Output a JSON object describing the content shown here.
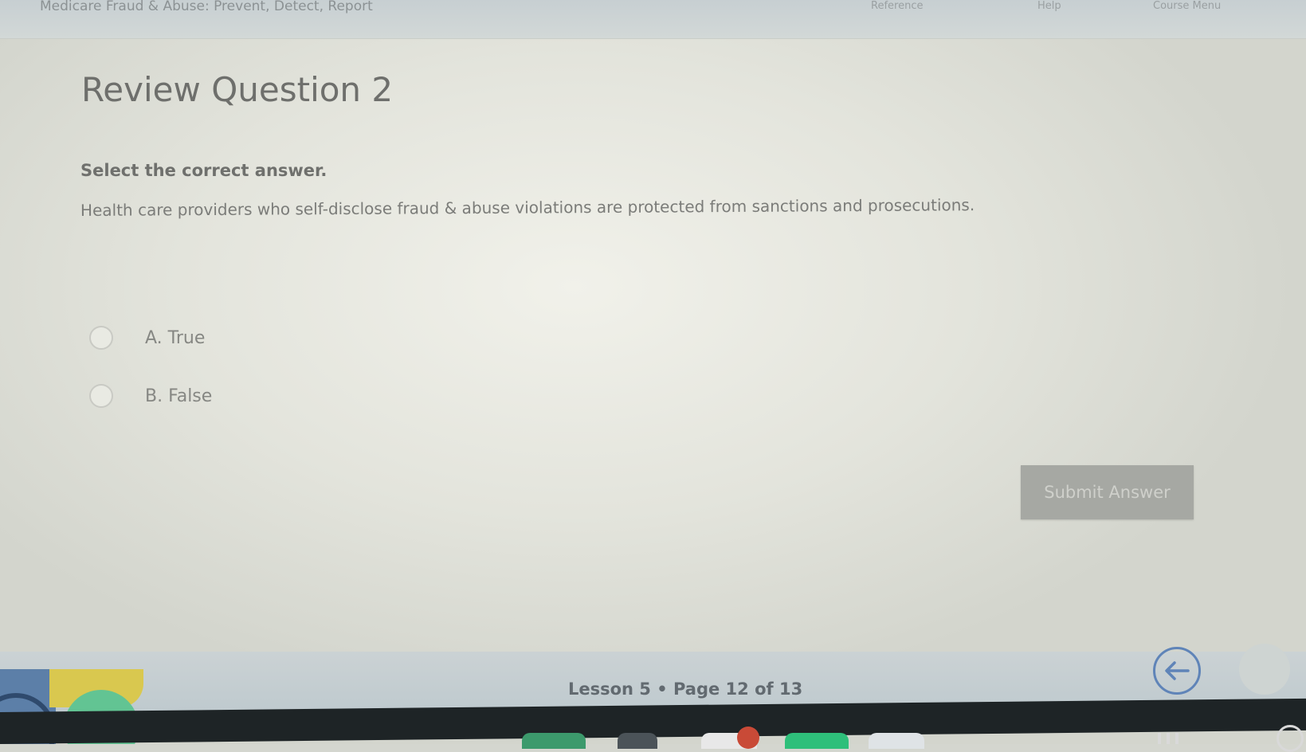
{
  "header": {
    "course_title": "Medicare Fraud & Abuse: Prevent, Detect, Report",
    "nav_links": [
      "Reference",
      "Help",
      "Course Menu"
    ]
  },
  "question": {
    "title": "Review Question 2",
    "instruction": "Select the correct answer.",
    "prompt": "Health care providers who self-disclose fraud & abuse violations are protected from sanctions and prosecutions.",
    "options": [
      {
        "label": "A. True",
        "selected": false
      },
      {
        "label": "B. False",
        "selected": false
      }
    ],
    "submit_label": "Submit Answer"
  },
  "footer": {
    "lesson_info": "Lesson 5 • Page 12 of 13"
  },
  "icons": {
    "back": "arrow-left-icon",
    "forward": "arrow-right-icon"
  },
  "colors": {
    "accent": "#5f84b8",
    "submit_bg": "#a6a8a3"
  }
}
